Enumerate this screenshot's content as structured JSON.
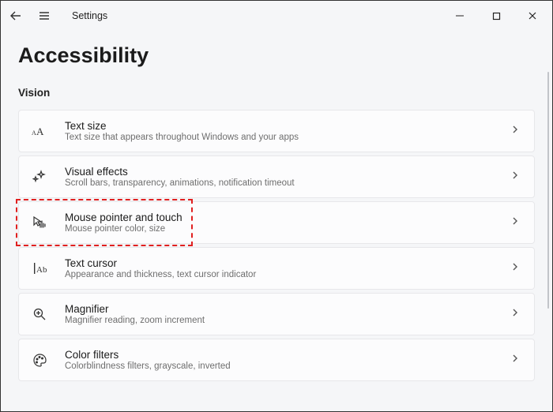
{
  "titlebar": {
    "title": "Settings"
  },
  "page": {
    "title": "Accessibility",
    "section": "Vision"
  },
  "items": [
    {
      "title": "Text size",
      "sub": "Text size that appears throughout Windows and your apps"
    },
    {
      "title": "Visual effects",
      "sub": "Scroll bars, transparency, animations, notification timeout"
    },
    {
      "title": "Mouse pointer and touch",
      "sub": "Mouse pointer color, size"
    },
    {
      "title": "Text cursor",
      "sub": "Appearance and thickness, text cursor indicator"
    },
    {
      "title": "Magnifier",
      "sub": "Magnifier reading, zoom increment"
    },
    {
      "title": "Color filters",
      "sub": "Colorblindness filters, grayscale, inverted"
    }
  ]
}
